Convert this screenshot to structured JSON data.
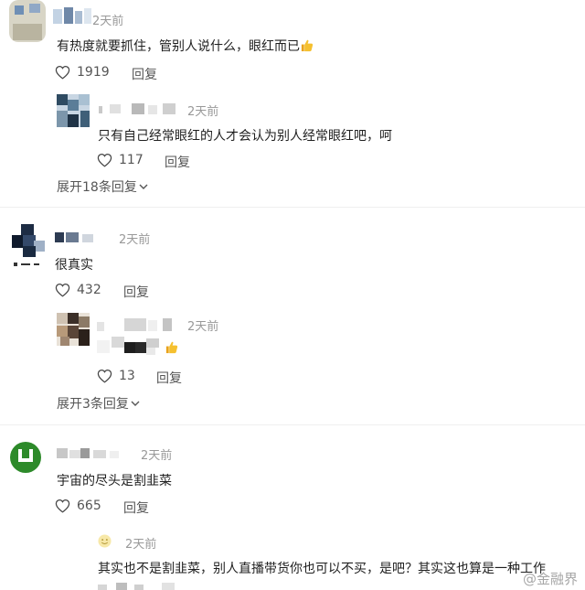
{
  "comments": [
    {
      "time": "2天前",
      "text": "有热度就要抓住，管别人说什么，眼红而已",
      "likes": "1919",
      "reply_label": "回复",
      "replies": [
        {
          "time": "2天前",
          "text": "只有自己经常眼红的人才会认为别人经常眼红吧，呵",
          "likes": "117",
          "reply_label": "回复"
        }
      ],
      "expand_label": "展开18条回复"
    },
    {
      "time": "2天前",
      "text": "很真实",
      "likes": "432",
      "reply_label": "回复",
      "replies": [
        {
          "time": "2天前",
          "text": "",
          "likes": "13",
          "reply_label": "回复"
        }
      ],
      "expand_label": "展开3条回复"
    },
    {
      "time": "2天前",
      "text": "宇宙的尽头是割韭菜",
      "likes": "665",
      "reply_label": "回复",
      "replies": [
        {
          "time": "2天前",
          "text": "其实也不是割韭菜，别人直播带货你也可以不买，是吧？其实这也算是一种工作"
        }
      ]
    }
  ],
  "icons": {
    "like": "heart-outline-icon",
    "thumbs_up": "thumbs-up-emoji-icon",
    "expand": "chevron-down-icon",
    "emoji": "smile-emoji-icon"
  },
  "colors": {
    "time": "#999999",
    "text": "#1f1f1f",
    "meta": "#555555"
  },
  "watermark": "@金融界"
}
